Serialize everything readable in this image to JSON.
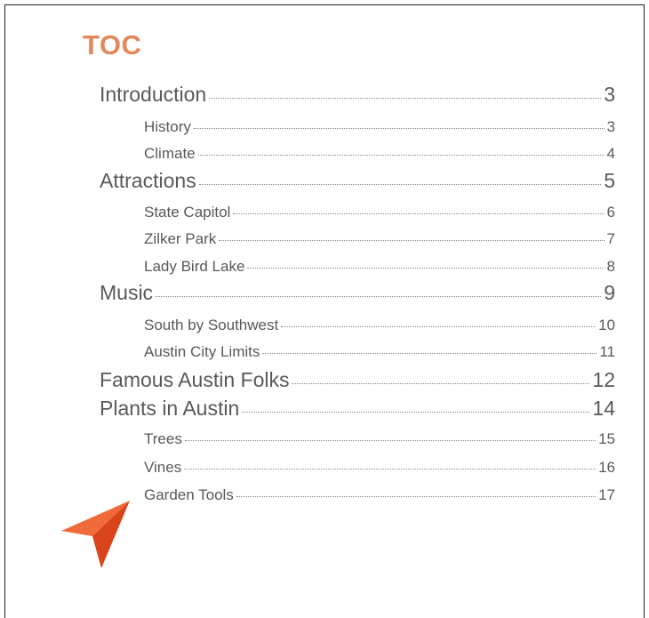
{
  "document": {
    "title": "TOC",
    "entries": [
      {
        "label": "Introduction",
        "page": "3",
        "level": 1
      },
      {
        "label": "History",
        "page": "3",
        "level": 2
      },
      {
        "label": "Climate",
        "page": "4",
        "level": 2
      },
      {
        "label": "Attractions",
        "page": "5",
        "level": 1
      },
      {
        "label": "State Capitol",
        "page": "6",
        "level": 2
      },
      {
        "label": "Zilker Park",
        "page": "7",
        "level": 2
      },
      {
        "label": "Lady Bird Lake",
        "page": "8",
        "level": 2
      },
      {
        "label": "Music",
        "page": "9",
        "level": 1
      },
      {
        "label": "South by Southwest",
        "page": "10",
        "level": 2
      },
      {
        "label": "Austin City Limits",
        "page": "11",
        "level": 2
      },
      {
        "label": "Famous Austin Folks",
        "page": "12",
        "level": 1
      },
      {
        "label": "Plants in Austin",
        "page": "14",
        "level": 1
      },
      {
        "label": "Trees",
        "page": "15",
        "level": 2
      },
      {
        "label": "Vines",
        "page": "16",
        "level": 2
      },
      {
        "label": "Garden Tools",
        "page": "17",
        "level": 2
      }
    ]
  },
  "colors": {
    "title": "#e2895b",
    "text": "#595959",
    "pointer": "#e8521f"
  },
  "icons": {
    "pointer": "navigation-arrow-icon"
  }
}
